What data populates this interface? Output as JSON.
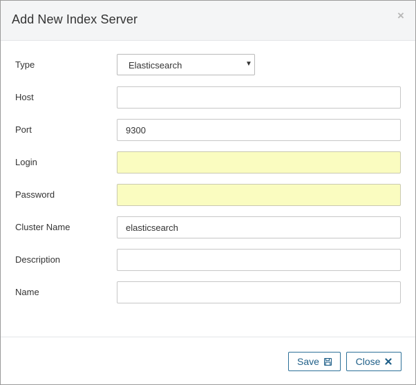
{
  "dialog": {
    "title": "Add New Index Server",
    "close_glyph": "×"
  },
  "form": {
    "type": {
      "label": "Type",
      "value": "Elasticsearch"
    },
    "host": {
      "label": "Host",
      "value": ""
    },
    "port": {
      "label": "Port",
      "value": "9300"
    },
    "login": {
      "label": "Login",
      "value": ""
    },
    "password": {
      "label": "Password",
      "value": ""
    },
    "cluster_name": {
      "label": "Cluster Name",
      "value": "elasticsearch"
    },
    "description": {
      "label": "Description",
      "value": ""
    },
    "name": {
      "label": "Name",
      "value": ""
    }
  },
  "footer": {
    "save_label": "Save",
    "close_label": "Close"
  },
  "colors": {
    "autofill": "#fafcc0",
    "button_border": "#2b6f97",
    "button_text": "#1f5f88"
  },
  "icons": {
    "save": "floppy-disk-icon",
    "close": "x-mark-icon",
    "dropdown": "caret-down-icon"
  }
}
